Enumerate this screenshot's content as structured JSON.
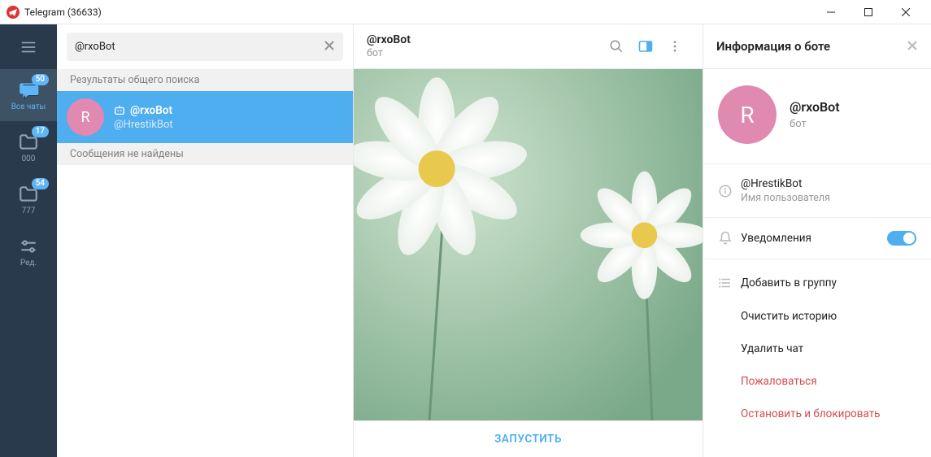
{
  "window": {
    "title": "Telegram (36633)"
  },
  "rail": {
    "folders": [
      {
        "label": "Все чаты",
        "badge": "50"
      },
      {
        "label": "000",
        "badge": "17"
      },
      {
        "label": "777",
        "badge": "54"
      },
      {
        "label": "Ред."
      }
    ]
  },
  "search": {
    "value": "@rxoBot",
    "results_header": "Результаты общего поиска",
    "not_found": "Сообщения не найдены",
    "result": {
      "avatar_letter": "R",
      "name": "@rxoBot",
      "sub": "@HrestikBot"
    }
  },
  "chat": {
    "name": "@rxoBot",
    "sub": "бот",
    "start_button": "ЗАПУСТИТЬ"
  },
  "info": {
    "header": "Информация о боте",
    "avatar_letter": "R",
    "name": "@rxoBot",
    "sub": "бот",
    "username": "@HrestikBot",
    "username_label": "Имя пользователя",
    "notifications": "Уведомления",
    "actions": {
      "add_to_group": "Добавить в группу",
      "clear_history": "Очистить историю",
      "delete_chat": "Удалить чат",
      "report": "Пожаловаться",
      "stop_block": "Остановить и блокировать"
    }
  }
}
